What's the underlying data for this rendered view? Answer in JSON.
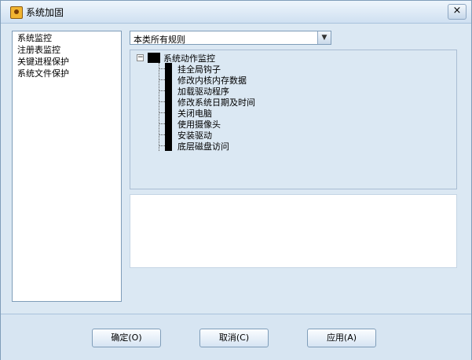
{
  "window": {
    "title": "系统加固",
    "close_label": "×"
  },
  "left_panel": {
    "items": [
      "系统监控",
      "注册表监控",
      "关键进程保护",
      "系统文件保护"
    ]
  },
  "filter": {
    "selected": "本类所有规则",
    "arrow": "▼"
  },
  "tree": {
    "expander": "−",
    "root_label": "系统动作监控",
    "children": [
      "挂全局钩子",
      "修改内核内存数据",
      "加载驱动程序",
      "修改系统日期及时间",
      "关闭电脑",
      "使用摄像头",
      "安装驱动",
      "底层磁盘访问"
    ]
  },
  "buttons": {
    "ok": "确定(O)",
    "cancel": "取消(C)",
    "apply": "应用(A)"
  }
}
